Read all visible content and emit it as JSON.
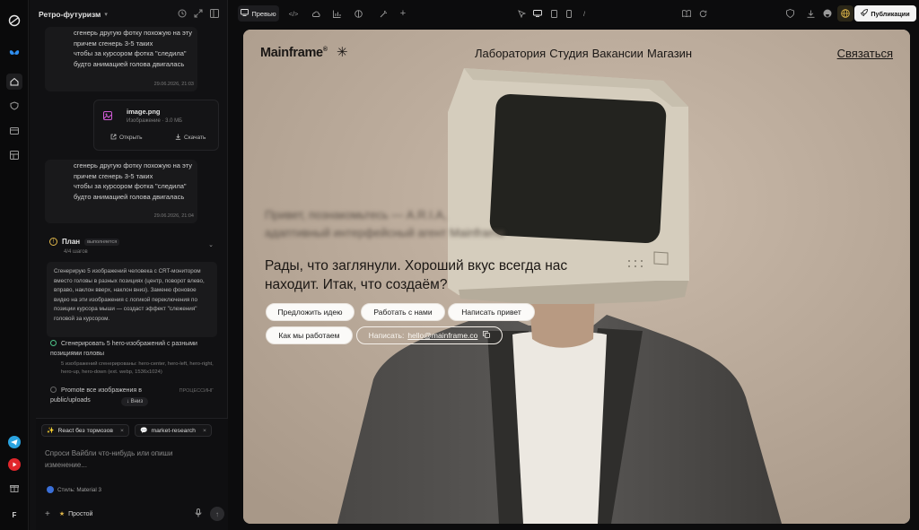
{
  "sidebar_rail": {
    "items": [
      "logo-icon",
      "butterfly-icon",
      "home-icon",
      "shield-icon",
      "card-icon",
      "layout-icon",
      "telegram-icon",
      "youtube-icon",
      "gift-icon"
    ],
    "avatar_letter": "F"
  },
  "chat": {
    "project_title": "Ретро-футуризм",
    "messages": [
      {
        "lines": [
          "сгенерь другую фотку похожую на эту",
          "причем сгенерь 3-5 таких",
          "чтобы за курсором фотка \"следила\"",
          "будто анимацией голова двигалась"
        ],
        "time": "29.06.2026, 21:03"
      },
      {
        "lines": [
          "сгенерь другую фотку похожую на эту",
          "причем сгенерь 3-5 таких",
          "чтобы за курсором фотка \"следила\"",
          "будто анимацией голова двигалась"
        ],
        "time": "29.06.2026, 21:04"
      }
    ],
    "file": {
      "name": "image.png",
      "meta": "Изображение · 3.0 МБ",
      "open_label": "Открыть",
      "download_label": "Скачать"
    },
    "plan": {
      "title": "План",
      "badge": "выполняется",
      "steps_count": "4/4 шагов",
      "description": "Сгенерирую 5 изображений человека с CRT-монитором вместо головы в разных позициях (центр, поворот влево, вправо, наклон вверх, наклон вниз). Заменю фоновое видео на эти изображения с логикой переключения по позиции курсора мыши — создаст эффект \"слежения\" головой за курсором.",
      "step1_title": "Сгенерировать 5 hero-изображений с разными позициями головы",
      "step1_sub": "5 изображений сгенерированы: hero-center, hero-left, hero-right, hero-up, hero-down (ext. webp, 1536x1024)",
      "step2_title": "Promote все изображения в public/uploads",
      "step2_status": "ПРОЦЕССИНГ",
      "down_label": "Вниз"
    },
    "composer": {
      "chip1": "React без тормозов",
      "chip2": "market-research",
      "placeholder": "Спроси Вайбли что-нибудь или опиши изменение...",
      "style_label": "Стиль: Material 3",
      "mode_label": "Простой"
    }
  },
  "toolbar": {
    "preview_label": "Превью",
    "publish_label": "Публикации"
  },
  "site": {
    "brand": "Mainframe",
    "brand_mark": "®",
    "spark": "✳",
    "nav_links": [
      "Лаборатория",
      "Студия",
      "Вакансии",
      "Магазин"
    ],
    "contact": "Связаться",
    "blurred_lines": [
      "Привет, познакомьтесь — A.R.I.A,",
      "адаптивный интерфейсный агент Mainframe"
    ],
    "headline": "Рады, что заглянули. Хороший вкус всегда нас находит. Итак, что создаём?",
    "buttons": [
      "Предложить идею",
      "Работать с нами",
      "Написать привет",
      "Как мы работаем"
    ],
    "email_prefix": "Написать:",
    "email": "hello@mainframe.co"
  },
  "colors": {
    "app_bg": "#0c0c0d",
    "panel_bg": "#111113",
    "accent_yellow": "#e0b74a",
    "success_green": "#4cbf86",
    "preview_bg": "#b9aa9b"
  }
}
